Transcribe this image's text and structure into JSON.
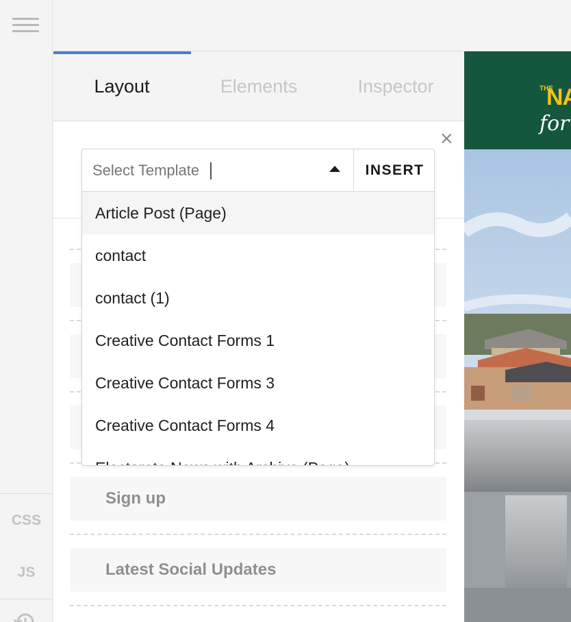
{
  "rail": {
    "css_label": "CSS",
    "js_label": "JS"
  },
  "tabs": [
    {
      "label": "Layout",
      "active": true
    },
    {
      "label": "Elements",
      "active": false
    },
    {
      "label": "Inspector",
      "active": false
    }
  ],
  "template_select": {
    "placeholder": "Select Template",
    "value": "",
    "insert_label": "INSERT",
    "close_symbol": "×",
    "options": [
      "Article Post (Page)",
      "contact",
      "contact (1)",
      "Creative Contact Forms 1",
      "Creative Contact Forms 3",
      "Creative Contact Forms 4",
      "Electorate News with Archive (Page)"
    ],
    "highlighted_index": 0
  },
  "blocks": [
    {
      "label": ""
    },
    {
      "label": ""
    },
    {
      "label": ""
    },
    {
      "label": "Sign up"
    },
    {
      "label": "Latest Social Updates"
    }
  ],
  "preview": {
    "logo_the": "THE",
    "logo_text": "NA",
    "logo_tagline": "for",
    "banner_color": "#15563f",
    "logo_color": "#f2c416"
  },
  "colors": {
    "accent": "#4a7fc1"
  }
}
